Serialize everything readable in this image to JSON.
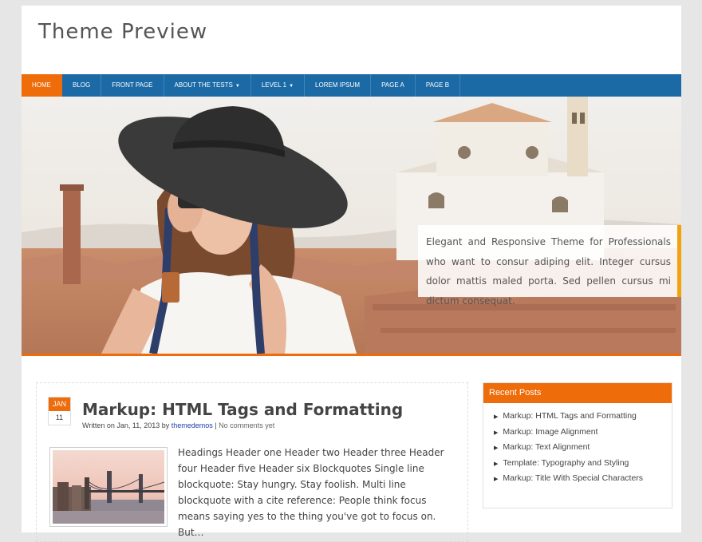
{
  "site": {
    "title": "Theme Preview"
  },
  "nav": {
    "items": [
      {
        "label": "Home",
        "active": true
      },
      {
        "label": "Blog"
      },
      {
        "label": "Front Page"
      },
      {
        "label": "About The Tests",
        "caret": true
      },
      {
        "label": "Level 1",
        "caret": true
      },
      {
        "label": "Lorem Ipsum"
      },
      {
        "label": "Page A"
      },
      {
        "label": "Page B"
      }
    ]
  },
  "hero": {
    "caption": "Elegant and Responsive Theme for Professionals who want to consur adiping elit. Integer cursus dolor mattis maled porta. Sed pellen cursus mi dictum consequat."
  },
  "post": {
    "date_month": "JAN",
    "date_day": "11",
    "title": "Markup: HTML Tags and Formatting",
    "meta_prefix": "Written on Jan, 11, 2013 by",
    "author": "themedemos",
    "separator": "|",
    "comments": "No comments yet",
    "excerpt": "Headings Header one Header two Header three Header four Header five Header six Blockquotes Single line blockquote: Stay hungry. Stay foolish. Multi line blockquote with a cite reference: People think focus means saying yes to the thing you've got to focus on. But…"
  },
  "sidebar": {
    "widget_title": "Recent Posts",
    "recent_posts": [
      "Markup: HTML Tags and Formatting",
      "Markup: Image Alignment",
      "Markup: Text Alignment",
      "Template: Typography and Styling",
      "Markup: Title With Special Characters"
    ]
  },
  "colors": {
    "accent": "#ee6c0a",
    "nav": "#1b6aa6",
    "caption_border": "#f1a20d"
  }
}
